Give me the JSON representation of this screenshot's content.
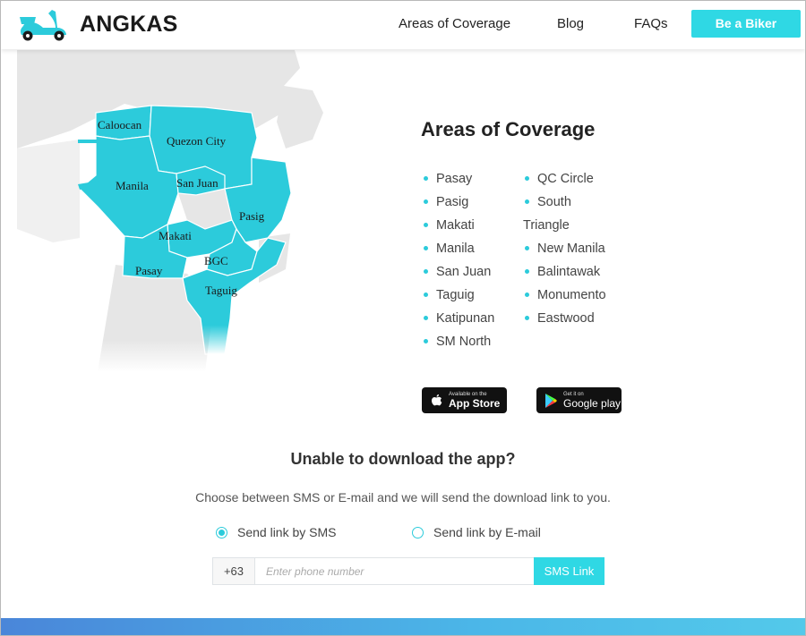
{
  "header": {
    "brand": "ANGKAS",
    "nav": {
      "areas": "Areas of Coverage",
      "blog": "Blog",
      "faqs": "FAQs"
    },
    "cta": "Be a Biker"
  },
  "map": {
    "labels": {
      "caloocan": "Caloocan",
      "quezon": "Quezon City",
      "manila": "Manila",
      "sanjuan": "San Juan",
      "pasig": "Pasig",
      "makati": "Makati",
      "bgc": "BGC",
      "pasay": "Pasay",
      "taguig": "Taguig"
    }
  },
  "coverage": {
    "title": "Areas of Coverage",
    "col1": [
      "Pasay",
      "Pasig",
      "Makati",
      "Manila",
      "San Juan",
      "Taguig",
      "Katipunan",
      "SM North"
    ],
    "col2": [
      "QC Circle",
      "South",
      "Triangle",
      "New Manila",
      "Balintawak",
      "Monumento",
      "Eastwood"
    ]
  },
  "stores": {
    "apple": {
      "small": "Available on the",
      "big": "App Store",
      "icon": "apple-icon"
    },
    "google": {
      "small": "Get it on",
      "big": "Google play",
      "icon": "play-icon"
    }
  },
  "download": {
    "title": "Unable to download the app?",
    "subtitle": "Choose between SMS or E-mail and we will send the download link to you.",
    "options": {
      "sms": "Send link by SMS",
      "email": "Send link by E-mail"
    },
    "prefix": "+63",
    "placeholder": "Enter phone number",
    "button": "SMS Link"
  },
  "colors": {
    "accent": "#2fd8e4",
    "map_fill": "#2ccbdb"
  }
}
